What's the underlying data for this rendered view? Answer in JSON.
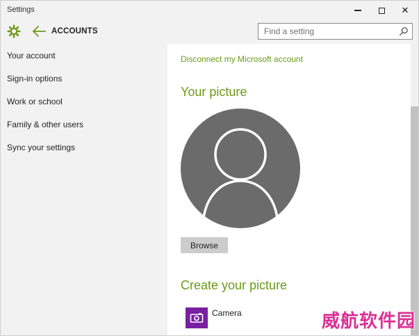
{
  "window": {
    "title": "Settings",
    "controls": {
      "minimize_icon": "minimize-icon",
      "maximize_icon": "maximize-icon",
      "close_glyph": "✕"
    }
  },
  "header": {
    "section_title": "ACCOUNTS",
    "gear_icon": "gear-icon",
    "back_icon": "back-arrow-icon",
    "search": {
      "placeholder": "Find a setting",
      "value": ""
    }
  },
  "sidebar": {
    "items": [
      {
        "label": "Your account"
      },
      {
        "label": "Sign-in options"
      },
      {
        "label": "Work or school"
      },
      {
        "label": "Family & other users"
      },
      {
        "label": "Sync your settings"
      }
    ]
  },
  "main": {
    "disconnect_link": "Disconnect my Microsoft account",
    "your_picture_heading": "Your picture",
    "browse_label": "Browse",
    "create_picture_heading": "Create your picture",
    "camera_label": "Camera"
  },
  "watermark": "威航软件园",
  "colors": {
    "accent": "#6b9a17",
    "chrome_bg": "#f2f2f2",
    "avatar_gray": "#6b6b6b",
    "camera_tile": "#7a1fa2",
    "watermark": "#d9268f"
  }
}
